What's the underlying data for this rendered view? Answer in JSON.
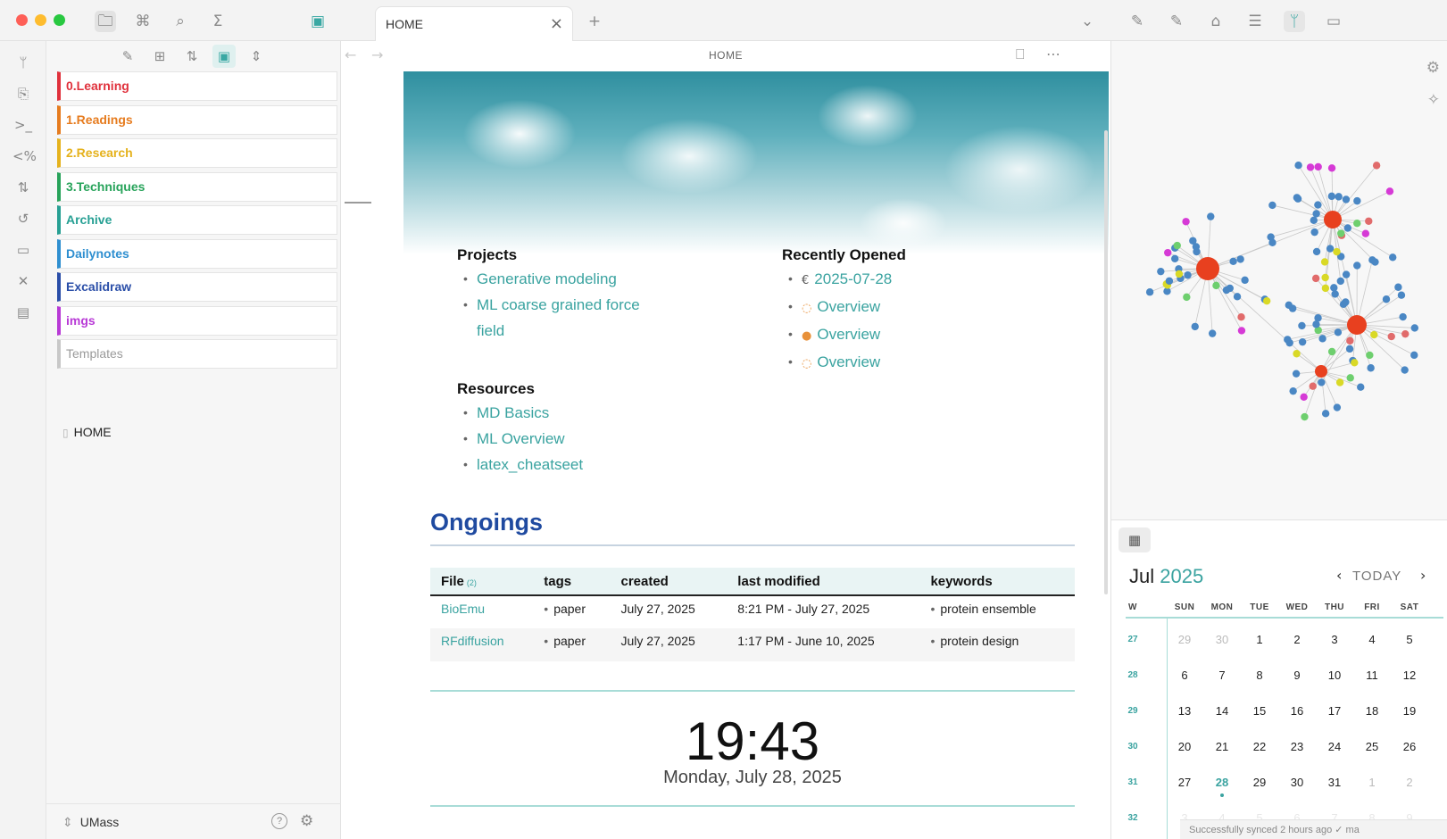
{
  "titlebar": {
    "tab_title": "HOME",
    "tab_close": "×",
    "new_tab": "+",
    "tab_list": "⌄",
    "left_icons": {
      "files": "🗀",
      "bookmarks": "⌘",
      "search": "⌕",
      "sum": "Σ",
      "sidebar_toggle": "▣"
    },
    "right_icons": {
      "i1": "✎",
      "i2": "✎",
      "i3": "⌂",
      "i4": "☰",
      "i5": "ᛘ",
      "i6": "▭"
    }
  },
  "ribbon": {
    "icons": [
      "ᛘ",
      "⎘",
      ">_",
      "<%",
      "⇅",
      "↺",
      "▭",
      "✕",
      "▤"
    ]
  },
  "file_explorer": {
    "tools": {
      "new_note": "✎",
      "new_folder": "⊞",
      "sort": "⇅",
      "collapse": "▣",
      "expand": "⇕"
    },
    "folders": [
      {
        "name": "0.Learning",
        "color": "#e0313c"
      },
      {
        "name": "1.Readings",
        "color": "#e67c1f"
      },
      {
        "name": "2.Research",
        "color": "#e5b21d"
      },
      {
        "name": "3.Techniques",
        "color": "#27a35a"
      },
      {
        "name": "Archive",
        "color": "#27a094"
      },
      {
        "name": "Dailynotes",
        "color": "#2f8fd0"
      },
      {
        "name": "Excalidraw",
        "color": "#2a4ea8"
      },
      {
        "name": "imgs",
        "color": "#b83ad6"
      },
      {
        "name": "Templates",
        "color": "#c8c8c8"
      }
    ],
    "file": "HOME",
    "vault_name": "UMass",
    "help_icon": "?",
    "settings_icon": "⚙"
  },
  "view": {
    "title": "HOME",
    "back": "←",
    "forward": "→",
    "reading_icon": "⎕",
    "more_icon": "⋯"
  },
  "home": {
    "projects": {
      "heading": "Projects",
      "items": [
        "Generative modeling",
        "ML coarse grained force field"
      ]
    },
    "recent": {
      "heading": "Recently Opened",
      "items": [
        {
          "marker": "€",
          "label": "2025-07-28",
          "marker_color": "#555555"
        },
        {
          "marker": "◌",
          "label": "Overview",
          "marker_color": "#e8913a"
        },
        {
          "marker": "●",
          "label": "Overview",
          "marker_color": "#e8913a"
        },
        {
          "marker": "◌",
          "label": "Overview",
          "marker_color": "#e8913a"
        }
      ]
    },
    "resources": {
      "heading": "Resources",
      "items": [
        "MD Basics",
        "ML Overview",
        "latex_cheatseet"
      ]
    },
    "ongoings": {
      "title": "Ongoings",
      "columns": [
        "File",
        "tags",
        "created",
        "last modified",
        "keywords"
      ],
      "count": "(2)",
      "rows": [
        {
          "file": "BioEmu",
          "tags": "paper",
          "created": "July 27, 2025",
          "modified": "8:21 PM - July 27, 2025",
          "keywords": "protein ensemble"
        },
        {
          "file": "RFdiffusion",
          "tags": "paper",
          "created": "July 27, 2025",
          "modified": "1:17 PM - June 10, 2025",
          "keywords": "protein design"
        }
      ]
    },
    "clock": "19:43",
    "date": "Monday, July 28, 2025"
  },
  "graph": {
    "settings_icon": "⚙",
    "magic_icon": "✧"
  },
  "calendar": {
    "tab_icon": "▦",
    "month": "Jul",
    "year": "2025",
    "today_label": "TODAY",
    "prev": "‹",
    "next": "›",
    "headers": [
      "W",
      "SUN",
      "MON",
      "TUE",
      "WED",
      "THU",
      "FRI",
      "SAT"
    ],
    "weeks": [
      {
        "w": "27",
        "days": [
          "29",
          "30",
          "1",
          "2",
          "3",
          "4",
          "5"
        ]
      },
      {
        "w": "28",
        "days": [
          "6",
          "7",
          "8",
          "9",
          "10",
          "11",
          "12"
        ]
      },
      {
        "w": "29",
        "days": [
          "13",
          "14",
          "15",
          "16",
          "17",
          "18",
          "19"
        ]
      },
      {
        "w": "30",
        "days": [
          "20",
          "21",
          "22",
          "23",
          "24",
          "25",
          "26"
        ]
      },
      {
        "w": "31",
        "days": [
          "27",
          "28",
          "29",
          "30",
          "31",
          "1",
          "2"
        ]
      },
      {
        "w": "32",
        "days": [
          "3",
          "4",
          "5",
          "6",
          "7",
          "8",
          "9"
        ]
      }
    ],
    "today": "28",
    "status": "Successfully synced 2 hours ago  ✓  ma"
  }
}
